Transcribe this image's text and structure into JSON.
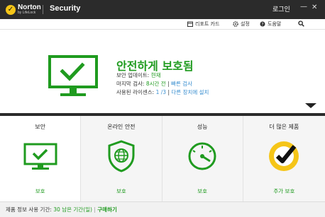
{
  "titlebar": {
    "brand": "Norton",
    "brand_sub": "by LifeLock",
    "title": "Security",
    "login": "로그인",
    "minimize": "—",
    "close": "✕"
  },
  "toolbar": {
    "report_card": "리포트 카드",
    "settings": "설정",
    "help": "도움말"
  },
  "hero": {
    "title": "안전하게 보호됨",
    "update_label": "보안 업데이트:",
    "update_value": "현재",
    "scan_label": "마지막 검사:",
    "scan_value": "8시간 전",
    "scan_sep": "|",
    "quick_scan": "빠른 검사",
    "license_label": "사용된 라이센스:",
    "license_value": "1 /3",
    "license_sep": "|",
    "install_other": "다른 장치에 설치"
  },
  "tiles": [
    {
      "title": "보안",
      "status": "보호",
      "icon": "monitor-check-icon"
    },
    {
      "title": "온라인 안전",
      "status": "보호",
      "icon": "shield-globe-icon"
    },
    {
      "title": "성능",
      "status": "보호",
      "icon": "gauge-icon"
    },
    {
      "title": "더 많은 제품",
      "status": "주가 보호",
      "icon": "norton-seal-icon"
    }
  ],
  "footer": {
    "label": "제품 정보 사용 기간:",
    "remaining": "30 남은 기간(일)",
    "sep": "|",
    "buy": "구매하기"
  },
  "colors": {
    "green": "#1f9b1f",
    "titlebar": "#2b2b2b",
    "link_blue": "#3a8fd0",
    "norton_yellow": "#f5c518"
  }
}
